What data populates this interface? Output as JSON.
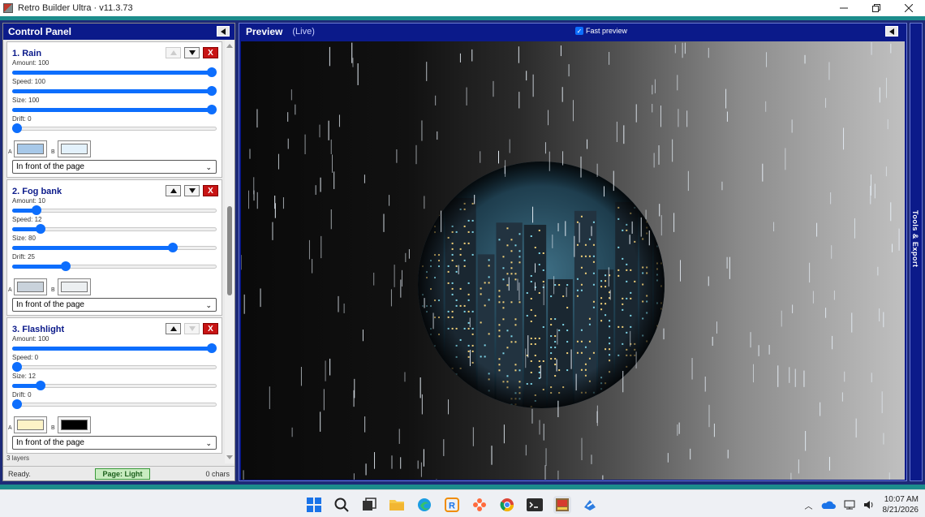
{
  "window": {
    "title": "Retro Builder Ultra",
    "version": "v11.3.73",
    "separator": "·"
  },
  "control_panel": {
    "title": "Control Panel",
    "layers": [
      {
        "title": "1. Rain",
        "up_enabled": false,
        "down_enabled": true,
        "delete_label": "X",
        "sliders": [
          {
            "label": "Amount: 100",
            "value": 100
          },
          {
            "label": "Speed: 100",
            "value": 100
          },
          {
            "label": "Size: 100",
            "value": 100
          },
          {
            "label": "Drift: 0",
            "value": 0
          }
        ],
        "color_a_label": "A",
        "color_b_label": "B",
        "color_a": "#a7c8e8",
        "color_b": "#e3f1fb",
        "position": "In front of the page"
      },
      {
        "title": "2. Fog bank",
        "up_enabled": true,
        "down_enabled": true,
        "delete_label": "X",
        "sliders": [
          {
            "label": "Amount: 10",
            "value": 10
          },
          {
            "label": "Speed: 12",
            "value": 12
          },
          {
            "label": "Size: 80",
            "value": 80
          },
          {
            "label": "Drift: 25",
            "value": 25
          }
        ],
        "color_a_label": "A",
        "color_b_label": "B",
        "color_a": "#c9d2db",
        "color_b": "#eceff1",
        "position": "In front of the page"
      },
      {
        "title": "3. Flashlight",
        "up_enabled": true,
        "down_enabled": false,
        "delete_label": "X",
        "sliders": [
          {
            "label": "Amount: 100",
            "value": 100
          },
          {
            "label": "Speed: 0",
            "value": 0
          },
          {
            "label": "Size: 12",
            "value": 12
          },
          {
            "label": "Drift: 0",
            "value": 0
          }
        ],
        "color_a_label": "A",
        "color_b_label": "B",
        "color_a": "#fdf3c7",
        "color_b": "#000000",
        "position": "In front of the page"
      }
    ],
    "layer_count": "3 layers",
    "status": "Ready.",
    "page_badge": "Page: Light",
    "char_count": "0 chars"
  },
  "preview": {
    "title": "Preview",
    "live": "(Live)",
    "fast_preview_label": "Fast preview",
    "fast_preview_checked": true
  },
  "tools_panel": {
    "label": "Tools & Export"
  },
  "taskbar": {
    "time": "10:07 AM",
    "date": "8/21/2026"
  },
  "colors": {
    "accent": "#0d6efd",
    "panel_blue": "#0b1a8a",
    "teal": "#1c8c8c",
    "delete_red": "#c81414"
  }
}
